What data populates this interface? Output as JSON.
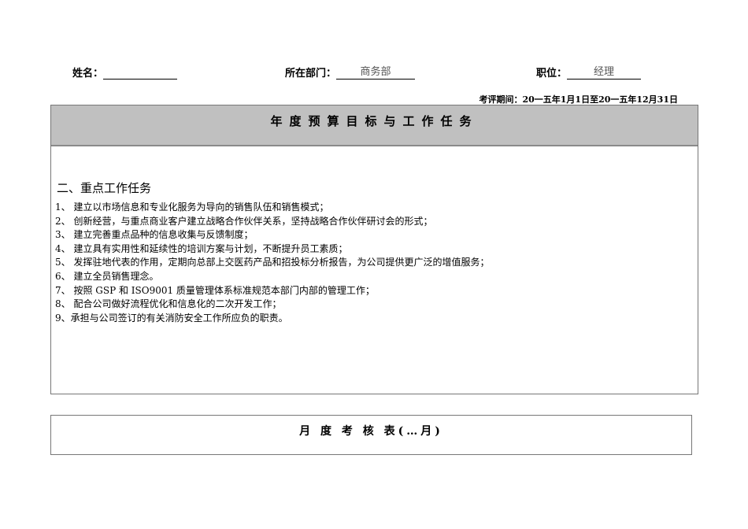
{
  "header": {
    "name_label": "姓名：",
    "name_value": "",
    "dept_label": "所在部门：",
    "dept_value": "商务部",
    "position_label": "职位：",
    "position_value": "经理",
    "period": "考评期间：20一五年1月1日至20一五年12月31日"
  },
  "annual": {
    "title": "年度预算目标与工作任务",
    "section_title": "二、重点工作任务",
    "tasks": [
      "1、 建立以市场信息和专业化服务为导向的销售队伍和销售模式；",
      "2、 创新经营，与重点商业客户建立战略合作伙伴关系，坚持战略合作伙伴研讨会的形式；",
      "3、 建立完善重点品种的信息收集与反馈制度；",
      "4、 建立具有实用性和延续性的培训方案与计划，不断提升员工素质；",
      "5、 发挥驻地代表的作用，定期向总部上交医药产品和招投标分析报告，为公司提供更广泛的增值服务；",
      "6、 建立全员销售理念。",
      "7、 按照 GSP 和 ISO9001 质量管理体系标准规范本部门内部的管理工作；",
      "8、 配合公司做好流程优化和信息化的二次开发工作；",
      "9、承担与公司签订的有关消防安全工作所应负的职责。"
    ]
  },
  "monthly": {
    "title": "月 度 考 核 表(…月)"
  }
}
